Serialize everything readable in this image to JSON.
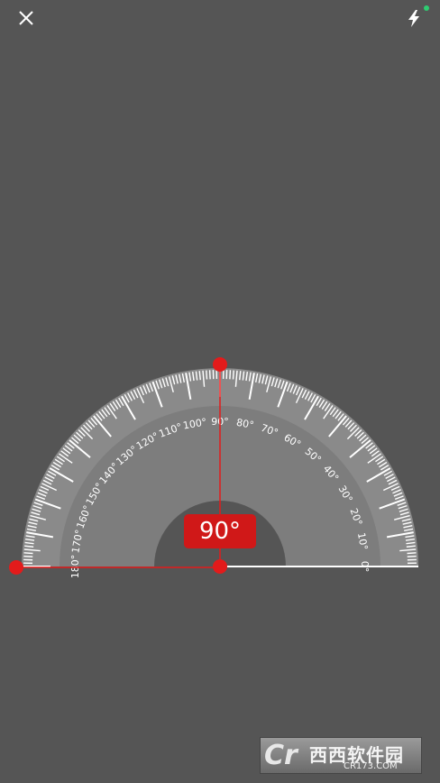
{
  "toolbar": {
    "close_icon": "close-icon",
    "flash_icon": "lightning-icon",
    "flash_indicator_color": "#2ecc71"
  },
  "protractor": {
    "angle_value": 90,
    "readout_text": "90°",
    "labels": [
      "180°",
      "170°",
      "160°",
      "150°",
      "140°",
      "130°",
      "120°",
      "110°",
      "100°",
      "90°",
      "80°",
      "70°",
      "60°",
      "50°",
      "40°",
      "30°",
      "20°",
      "10°",
      "0°"
    ],
    "accent_color": "#e31b1b",
    "scale_color": "#ffffff",
    "background_color": "#555555"
  },
  "watermark": {
    "logo_text": "Cr",
    "name": "西西软件园",
    "url": "CR173.COM"
  }
}
